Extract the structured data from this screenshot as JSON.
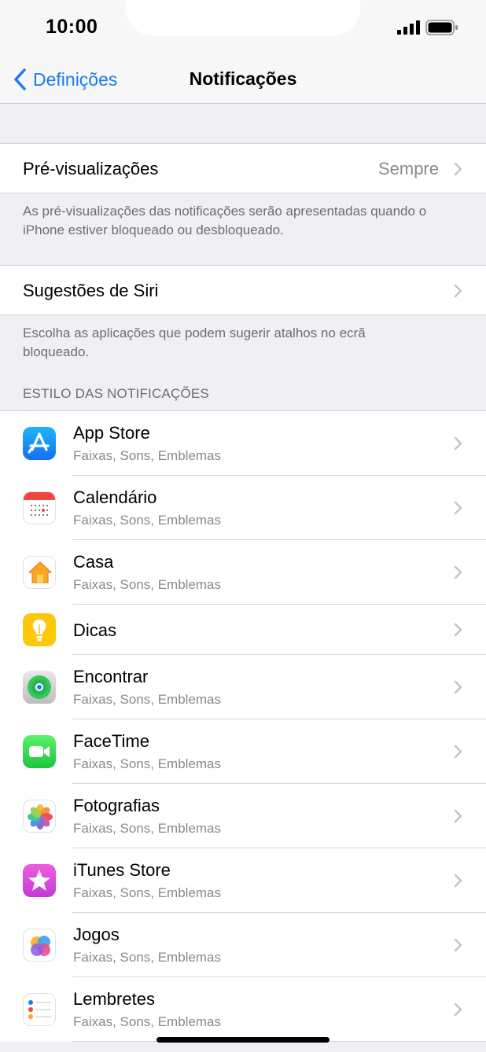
{
  "status_bar": {
    "time": "10:00"
  },
  "nav": {
    "back_label": "Definições",
    "title": "Notificações"
  },
  "previews": {
    "label": "Pré-visualizações",
    "value": "Sempre",
    "footnote": "As pré-visualizações das notificações serão apresentadas quando o iPhone estiver bloqueado ou desbloqueado."
  },
  "siri": {
    "label": "Sugestões de Siri",
    "footnote": "Escolha as aplicações que podem sugerir atalhos no ecrã bloqueado."
  },
  "section_header": "ESTILO DAS NOTIFICAÇÕES",
  "apps": [
    {
      "name": "App Store",
      "subtitle": "Faixas, Sons, Emblemas",
      "icon": "app-store-icon"
    },
    {
      "name": "Calendário",
      "subtitle": "Faixas, Sons, Emblemas",
      "icon": "calendar-icon"
    },
    {
      "name": "Casa",
      "subtitle": "Faixas, Sons, Emblemas",
      "icon": "home-icon"
    },
    {
      "name": "Dicas",
      "subtitle": "",
      "icon": "tips-icon"
    },
    {
      "name": "Encontrar",
      "subtitle": "Faixas, Sons, Emblemas",
      "icon": "find-my-icon"
    },
    {
      "name": "FaceTime",
      "subtitle": "Faixas, Sons, Emblemas",
      "icon": "facetime-icon"
    },
    {
      "name": "Fotografias",
      "subtitle": "Faixas, Sons, Emblemas",
      "icon": "photos-icon"
    },
    {
      "name": "iTunes Store",
      "subtitle": "Faixas, Sons, Emblemas",
      "icon": "itunes-store-icon"
    },
    {
      "name": "Jogos",
      "subtitle": "Faixas, Sons, Emblemas",
      "icon": "game-center-icon"
    },
    {
      "name": "Lembretes",
      "subtitle": "Faixas, Sons, Emblemas",
      "icon": "reminders-icon"
    }
  ],
  "colors": {
    "accent": "#1a7cf5",
    "background": "#efeff4",
    "secondary_text": "#8a8a8e"
  }
}
